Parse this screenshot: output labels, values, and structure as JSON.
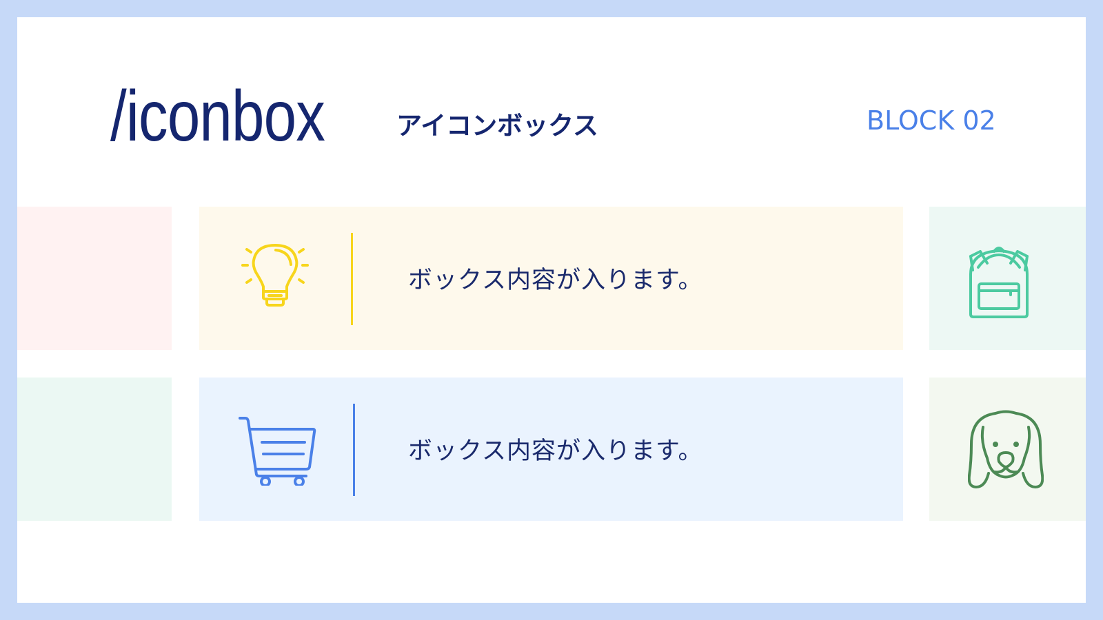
{
  "header": {
    "title": "/iconbox",
    "subtitle": "アイコンボックス",
    "block_label": "BLOCK 02"
  },
  "colors": {
    "frame": "#c6d9f8",
    "title": "#15266f",
    "accent": "#4a80e8",
    "yellow": "#f7d51c",
    "blue": "#4a80e8",
    "teal": "#4ccaa0",
    "green": "#4c8a55"
  },
  "cards": [
    {
      "icon": "lightbulb-icon",
      "text": "ボックス内容が入ります。"
    },
    {
      "icon": "shopping-cart-icon",
      "text": "ボックス内容が入ります。"
    },
    {
      "icon": "backpack-icon"
    },
    {
      "icon": "dog-icon"
    }
  ]
}
